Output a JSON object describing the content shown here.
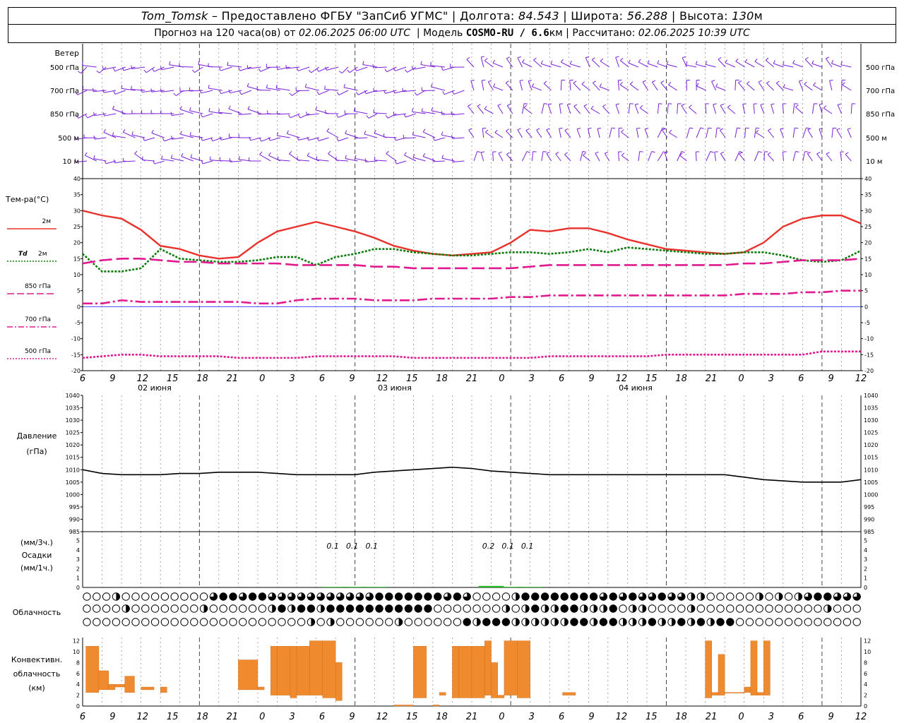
{
  "header": {
    "station": "Tom_Tomsk",
    "provider": "–  Предоставлено ФГБУ \"ЗапСиб УГМС\"",
    "lon_label": "Долгота:",
    "lon_value": "84.543",
    "lat_label": "Широта:",
    "lat_value": "56.288",
    "alt_label": "Высота:",
    "alt_value": "130",
    "alt_unit": "м",
    "forecast_label": "Прогноз на 120 часа(ов) от",
    "forecast_from": "02.06.2025 06:00 UTC",
    "model_label": "Модель",
    "model_name": "COSMO-RU / 6.6",
    "model_unit": "км",
    "calc_label": "Рассчитано:",
    "calc_time": "02.06.2025 10:39 UTC"
  },
  "colors": {
    "wind_barb": "#7a1fd8",
    "t2m": "#e8322b",
    "td2m": "#0a7a0a",
    "t850": "#e01a8e",
    "t700": "#e01a8e",
    "t500": "#e01a8e",
    "zero_line": "#3030ff",
    "pressure": "#000000",
    "precip": "#22bb22",
    "convective": "#f08a2e"
  },
  "wind_panel": {
    "title": "Ветер",
    "levels": [
      "500 гПа",
      "700 гПа",
      "850 гПа",
      "500  м",
      "10   м"
    ]
  },
  "temp_panel": {
    "title": "Тем-ра(°С)",
    "legend": [
      {
        "key": "t2m",
        "label": "2м",
        "style": "solid"
      },
      {
        "key": "td2m",
        "label": "2м",
        "prefix": "Td",
        "style": "dotted"
      },
      {
        "key": "t850",
        "label": "850 гПа",
        "style": "dashed"
      },
      {
        "key": "t700",
        "label": "700 гПа",
        "style": "dashdot"
      },
      {
        "key": "t500",
        "label": "500 гПа",
        "style": "dotted"
      }
    ],
    "y_ticks": [
      "40",
      "35",
      "30",
      "25",
      "20",
      "15",
      "10",
      "5",
      "0",
      "-5",
      "-10",
      "-15",
      "-20"
    ]
  },
  "time_axis": {
    "hour_labels": [
      "6",
      "9",
      "12",
      "15",
      "18",
      "21",
      "0",
      "3",
      "6",
      "9",
      "12",
      "15",
      "18",
      "21",
      "0",
      "3",
      "6",
      "9",
      "12",
      "15",
      "18",
      "21",
      "0",
      "3",
      "6",
      "9",
      "12"
    ],
    "day_labels": [
      "02 июня",
      "03 июня",
      "04 июня"
    ]
  },
  "pressure_panel": {
    "title1": "Давление",
    "title2": "(гПа)",
    "y_ticks": [
      "1040",
      "1035",
      "1030",
      "1025",
      "1020",
      "1015",
      "1010",
      "1005",
      "1000",
      "995",
      "990",
      "985"
    ]
  },
  "precip_panel": {
    "title1": "(мм/3ч.)",
    "title2": "Осадки",
    "title3": "(мм/1ч.)",
    "y_ticks": [
      "5",
      "4",
      "3",
      "2",
      "1",
      "0"
    ],
    "annotations": [
      "0.1",
      "0.1",
      "0.1",
      "0.2",
      "0.1",
      "0.1"
    ]
  },
  "cloud_panel": {
    "title": "Облачность"
  },
  "conv_panel": {
    "title1": "Конвективн.",
    "title2": "облачность",
    "title3": "(км)",
    "y_ticks": [
      "12",
      "10",
      "8",
      "6",
      "4",
      "2",
      "0"
    ]
  },
  "chart_data": [
    {
      "type": "line",
      "title": "Тем-ра(°С)",
      "x_hours_from_start": [
        0,
        3,
        6,
        9,
        12,
        15,
        18,
        21,
        24,
        27,
        30,
        33,
        36,
        39,
        42,
        45,
        48,
        51,
        54,
        57,
        60,
        63,
        66,
        69,
        72,
        75,
        78,
        81,
        84,
        87,
        90,
        93,
        96,
        99,
        102,
        105,
        108,
        111,
        114,
        117,
        120
      ],
      "ylim": [
        -20,
        40
      ],
      "series": [
        {
          "name": "2м",
          "values": [
            30,
            28.5,
            27.5,
            24,
            19,
            18,
            16,
            15,
            15.5,
            20,
            23.5,
            25,
            26.5,
            25,
            23.5,
            21.5,
            19,
            17.5,
            16.5,
            16,
            16.5,
            17,
            20,
            24,
            23.5,
            24.5,
            24.5,
            23,
            21,
            19.5,
            18,
            17.5,
            17,
            16.5,
            17,
            20,
            25,
            27.5,
            28.5,
            28.5,
            26
          ]
        },
        {
          "name": "Td 2м",
          "values": [
            16.5,
            11,
            11,
            12,
            18,
            15,
            14.5,
            14,
            14,
            14.5,
            15.5,
            15.5,
            13,
            15.5,
            16.5,
            18,
            18,
            17,
            16.5,
            16,
            16,
            16.5,
            17,
            17,
            16.5,
            17,
            18,
            17,
            18.5,
            18,
            17.5,
            17,
            16.5,
            16.5,
            17,
            17,
            16,
            14.5,
            14,
            14.5,
            17.5
          ]
        },
        {
          "name": "850 гПа",
          "values": [
            13.5,
            14.5,
            15,
            15,
            14.5,
            14,
            14,
            13.5,
            13.5,
            13.5,
            13.5,
            13,
            13,
            13,
            13,
            12.5,
            12.5,
            12,
            12,
            12,
            12,
            12,
            12,
            12.5,
            13,
            13,
            13,
            13,
            13,
            13,
            13,
            13,
            13,
            13,
            13.5,
            13.5,
            14,
            14.5,
            14.5,
            14.5,
            15
          ]
        },
        {
          "name": "700 гПа",
          "values": [
            1,
            1,
            2,
            1.5,
            1.5,
            1.5,
            1.5,
            1.5,
            1.5,
            1,
            1,
            2,
            2.5,
            2.5,
            2.5,
            2,
            2,
            2,
            2.5,
            2.5,
            2.5,
            2.5,
            3,
            3,
            3.5,
            3.5,
            3.5,
            3.5,
            3.5,
            3.5,
            3.5,
            3.5,
            3.5,
            3.5,
            4,
            4,
            4,
            4.5,
            4.5,
            5,
            5
          ]
        },
        {
          "name": "500 гПа",
          "values": [
            -16,
            -15.5,
            -15,
            -15,
            -15.5,
            -15.5,
            -15.5,
            -15.5,
            -16,
            -16,
            -16,
            -16,
            -15.5,
            -15.5,
            -15.5,
            -15.5,
            -15.5,
            -16,
            -16,
            -16,
            -16,
            -16,
            -16,
            -16,
            -15.5,
            -15.5,
            -15.5,
            -15.5,
            -15.5,
            -15.5,
            -15,
            -15,
            -15,
            -15,
            -15,
            -15,
            -15,
            -15,
            -14,
            -14,
            -14
          ]
        }
      ]
    },
    {
      "type": "line",
      "title": "Давление (гПа)",
      "x_hours_from_start": [
        0,
        3,
        6,
        9,
        12,
        15,
        18,
        21,
        24,
        27,
        30,
        33,
        36,
        39,
        42,
        45,
        48,
        51,
        54,
        57,
        60,
        63,
        66,
        69,
        72,
        75,
        78,
        81,
        84,
        87,
        90,
        93,
        96,
        99,
        102,
        105,
        108,
        111,
        114,
        117,
        120
      ],
      "ylim": [
        985,
        1040
      ],
      "series": [
        {
          "name": "Давление",
          "values": [
            1010,
            1008.5,
            1008,
            1008,
            1008,
            1008.5,
            1008.5,
            1009,
            1009,
            1009,
            1008.5,
            1008,
            1008,
            1008,
            1008,
            1009,
            1009.5,
            1010,
            1010.5,
            1011,
            1010.5,
            1009.5,
            1009,
            1008.5,
            1008,
            1008,
            1008,
            1008,
            1008,
            1008,
            1008,
            1008,
            1008,
            1008,
            1007,
            1006,
            1005.5,
            1005,
            1005,
            1005,
            1006
          ]
        }
      ]
    },
    {
      "type": "bar",
      "title": "Осадки",
      "x_hours_from_start": [
        39,
        42,
        45,
        63,
        66,
        69
      ],
      "ylim": [
        0,
        5
      ],
      "series": [
        {
          "name": "Осадки (мм/3ч.)",
          "values": [
            0.1,
            0.1,
            0.1,
            0.2,
            0.1,
            0.1
          ]
        }
      ]
    },
    {
      "type": "bar",
      "title": "Конвективн. облачность (км)",
      "ylim": [
        0,
        13
      ],
      "bars": [
        {
          "x_from": 0.5,
          "x_to": 2.5,
          "base": 2.5,
          "top": 11
        },
        {
          "x_from": 2.5,
          "x_to": 4,
          "base": 3,
          "top": 6.5
        },
        {
          "x_from": 4,
          "x_to": 5,
          "base": 3,
          "top": 4
        },
        {
          "x_from": 5,
          "x_to": 6.5,
          "base": 3.5,
          "top": 4
        },
        {
          "x_from": 6.5,
          "x_to": 8,
          "base": 2.5,
          "top": 5.5
        },
        {
          "x_from": 9,
          "x_to": 11,
          "base": 3,
          "top": 3.5
        },
        {
          "x_from": 12,
          "x_to": 13,
          "base": 2.5,
          "top": 3.5
        },
        {
          "x_from": 24,
          "x_to": 27,
          "base": 3,
          "top": 8.5
        },
        {
          "x_from": 27,
          "x_to": 28,
          "base": 3,
          "top": 3.5
        },
        {
          "x_from": 29,
          "x_to": 30,
          "base": 2,
          "top": 11
        },
        {
          "x_from": 30,
          "x_to": 32,
          "base": 2,
          "top": 11
        },
        {
          "x_from": 32,
          "x_to": 33,
          "base": 1.5,
          "top": 11
        },
        {
          "x_from": 33,
          "x_to": 35,
          "base": 2,
          "top": 11
        },
        {
          "x_from": 35,
          "x_to": 37,
          "base": 2,
          "top": 12
        },
        {
          "x_from": 37,
          "x_to": 39,
          "base": 1.5,
          "top": 12
        },
        {
          "x_from": 39,
          "x_to": 40,
          "base": 1,
          "top": 8
        },
        {
          "x_from": 48,
          "x_to": 51,
          "base": 0,
          "top": 0.2
        },
        {
          "x_from": 51,
          "x_to": 53,
          "base": 1.5,
          "top": 11
        },
        {
          "x_from": 54,
          "x_to": 55,
          "base": 0,
          "top": 0.2
        },
        {
          "x_from": 55,
          "x_to": 56,
          "base": 2,
          "top": 2.5
        },
        {
          "x_from": 57,
          "x_to": 58,
          "base": 1.5,
          "top": 11
        },
        {
          "x_from": 58,
          "x_to": 60,
          "base": 1.5,
          "top": 11
        },
        {
          "x_from": 60,
          "x_to": 62,
          "base": 1.5,
          "top": 11
        },
        {
          "x_from": 62,
          "x_to": 63,
          "base": 2,
          "top": 12
        },
        {
          "x_from": 63,
          "x_to": 64,
          "base": 1.5,
          "top": 8
        },
        {
          "x_from": 64,
          "x_to": 65,
          "base": 1.5,
          "top": 2
        },
        {
          "x_from": 65,
          "x_to": 67,
          "base": 2,
          "top": 12
        },
        {
          "x_from": 67,
          "x_to": 69,
          "base": 1.5,
          "top": 12
        },
        {
          "x_from": 74,
          "x_to": 76,
          "base": 2,
          "top": 2.5
        },
        {
          "x_from": 96,
          "x_to": 97,
          "base": 1.5,
          "top": 12
        },
        {
          "x_from": 97,
          "x_to": 98,
          "base": 2,
          "top": 2.5
        },
        {
          "x_from": 98,
          "x_to": 99,
          "base": 2,
          "top": 9.5
        },
        {
          "x_from": 99,
          "x_to": 102,
          "base": 2.5,
          "top": 2.5
        },
        {
          "x_from": 102,
          "x_to": 103,
          "base": 2.5,
          "top": 3.5
        },
        {
          "x_from": 103,
          "x_to": 104,
          "base": 2,
          "top": 12
        },
        {
          "x_from": 104,
          "x_to": 105,
          "base": 2,
          "top": 2.5
        },
        {
          "x_from": 105,
          "x_to": 106,
          "base": 2,
          "top": 12
        }
      ]
    }
  ]
}
